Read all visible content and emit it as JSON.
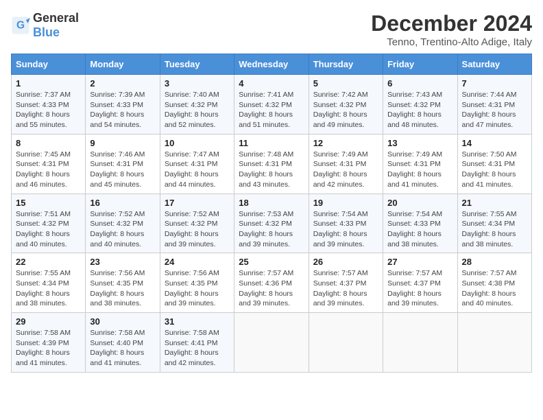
{
  "header": {
    "logo_general": "General",
    "logo_blue": "Blue",
    "title": "December 2024",
    "subtitle": "Tenno, Trentino-Alto Adige, Italy"
  },
  "days_of_week": [
    "Sunday",
    "Monday",
    "Tuesday",
    "Wednesday",
    "Thursday",
    "Friday",
    "Saturday"
  ],
  "weeks": [
    [
      {
        "day": "1",
        "sunrise": "7:37 AM",
        "sunset": "4:33 PM",
        "daylight": "8 hours and 55 minutes."
      },
      {
        "day": "2",
        "sunrise": "7:39 AM",
        "sunset": "4:33 PM",
        "daylight": "8 hours and 54 minutes."
      },
      {
        "day": "3",
        "sunrise": "7:40 AM",
        "sunset": "4:32 PM",
        "daylight": "8 hours and 52 minutes."
      },
      {
        "day": "4",
        "sunrise": "7:41 AM",
        "sunset": "4:32 PM",
        "daylight": "8 hours and 51 minutes."
      },
      {
        "day": "5",
        "sunrise": "7:42 AM",
        "sunset": "4:32 PM",
        "daylight": "8 hours and 49 minutes."
      },
      {
        "day": "6",
        "sunrise": "7:43 AM",
        "sunset": "4:32 PM",
        "daylight": "8 hours and 48 minutes."
      },
      {
        "day": "7",
        "sunrise": "7:44 AM",
        "sunset": "4:31 PM",
        "daylight": "8 hours and 47 minutes."
      }
    ],
    [
      {
        "day": "8",
        "sunrise": "7:45 AM",
        "sunset": "4:31 PM",
        "daylight": "8 hours and 46 minutes."
      },
      {
        "day": "9",
        "sunrise": "7:46 AM",
        "sunset": "4:31 PM",
        "daylight": "8 hours and 45 minutes."
      },
      {
        "day": "10",
        "sunrise": "7:47 AM",
        "sunset": "4:31 PM",
        "daylight": "8 hours and 44 minutes."
      },
      {
        "day": "11",
        "sunrise": "7:48 AM",
        "sunset": "4:31 PM",
        "daylight": "8 hours and 43 minutes."
      },
      {
        "day": "12",
        "sunrise": "7:49 AM",
        "sunset": "4:31 PM",
        "daylight": "8 hours and 42 minutes."
      },
      {
        "day": "13",
        "sunrise": "7:49 AM",
        "sunset": "4:31 PM",
        "daylight": "8 hours and 41 minutes."
      },
      {
        "day": "14",
        "sunrise": "7:50 AM",
        "sunset": "4:31 PM",
        "daylight": "8 hours and 41 minutes."
      }
    ],
    [
      {
        "day": "15",
        "sunrise": "7:51 AM",
        "sunset": "4:32 PM",
        "daylight": "8 hours and 40 minutes."
      },
      {
        "day": "16",
        "sunrise": "7:52 AM",
        "sunset": "4:32 PM",
        "daylight": "8 hours and 40 minutes."
      },
      {
        "day": "17",
        "sunrise": "7:52 AM",
        "sunset": "4:32 PM",
        "daylight": "8 hours and 39 minutes."
      },
      {
        "day": "18",
        "sunrise": "7:53 AM",
        "sunset": "4:32 PM",
        "daylight": "8 hours and 39 minutes."
      },
      {
        "day": "19",
        "sunrise": "7:54 AM",
        "sunset": "4:33 PM",
        "daylight": "8 hours and 39 minutes."
      },
      {
        "day": "20",
        "sunrise": "7:54 AM",
        "sunset": "4:33 PM",
        "daylight": "8 hours and 38 minutes."
      },
      {
        "day": "21",
        "sunrise": "7:55 AM",
        "sunset": "4:34 PM",
        "daylight": "8 hours and 38 minutes."
      }
    ],
    [
      {
        "day": "22",
        "sunrise": "7:55 AM",
        "sunset": "4:34 PM",
        "daylight": "8 hours and 38 minutes."
      },
      {
        "day": "23",
        "sunrise": "7:56 AM",
        "sunset": "4:35 PM",
        "daylight": "8 hours and 38 minutes."
      },
      {
        "day": "24",
        "sunrise": "7:56 AM",
        "sunset": "4:35 PM",
        "daylight": "8 hours and 39 minutes."
      },
      {
        "day": "25",
        "sunrise": "7:57 AM",
        "sunset": "4:36 PM",
        "daylight": "8 hours and 39 minutes."
      },
      {
        "day": "26",
        "sunrise": "7:57 AM",
        "sunset": "4:37 PM",
        "daylight": "8 hours and 39 minutes."
      },
      {
        "day": "27",
        "sunrise": "7:57 AM",
        "sunset": "4:37 PM",
        "daylight": "8 hours and 39 minutes."
      },
      {
        "day": "28",
        "sunrise": "7:57 AM",
        "sunset": "4:38 PM",
        "daylight": "8 hours and 40 minutes."
      }
    ],
    [
      {
        "day": "29",
        "sunrise": "7:58 AM",
        "sunset": "4:39 PM",
        "daylight": "8 hours and 41 minutes."
      },
      {
        "day": "30",
        "sunrise": "7:58 AM",
        "sunset": "4:40 PM",
        "daylight": "8 hours and 41 minutes."
      },
      {
        "day": "31",
        "sunrise": "7:58 AM",
        "sunset": "4:41 PM",
        "daylight": "8 hours and 42 minutes."
      },
      null,
      null,
      null,
      null
    ]
  ],
  "labels": {
    "sunrise": "Sunrise: ",
    "sunset": "Sunset: ",
    "daylight": "Daylight: "
  }
}
